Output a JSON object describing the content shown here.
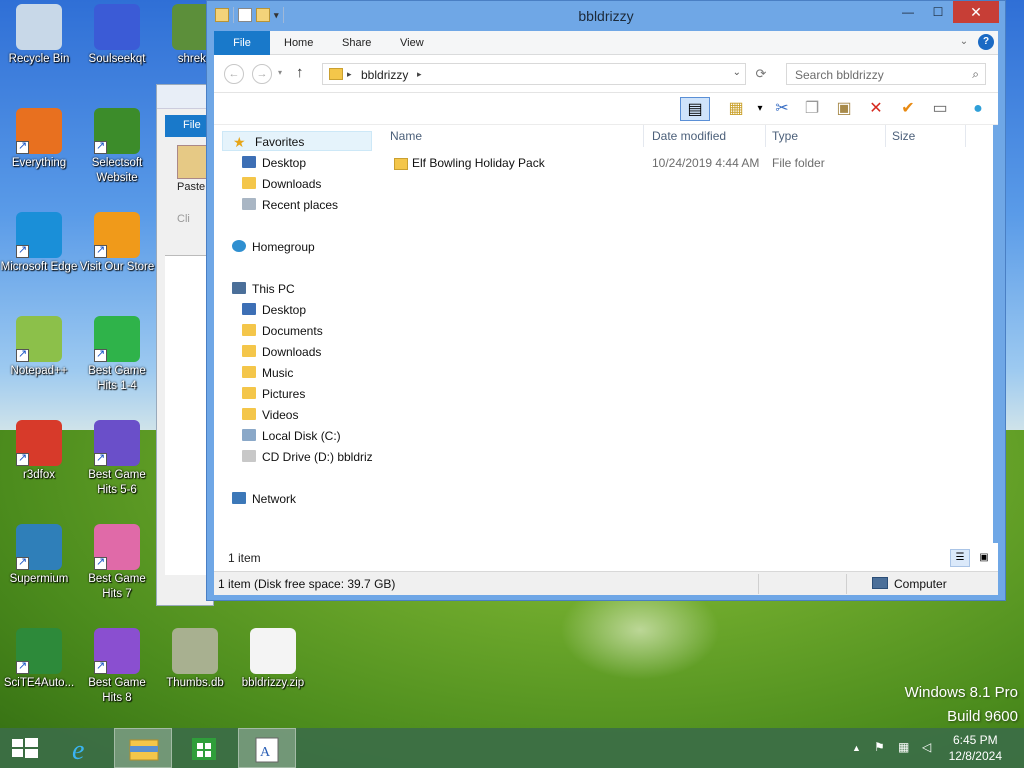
{
  "desktop": {
    "icons": [
      {
        "label": "Recycle Bin",
        "icon": "recycle-bin-icon",
        "color": "#c8d8e8"
      },
      {
        "label": "Soulseekqt",
        "icon": "bird-icon",
        "color": "#3b5bd6"
      },
      {
        "label": "shrekp",
        "icon": "shrek-icon",
        "color": "#5c8f3a"
      },
      {
        "label": "Everything",
        "icon": "magnifier-icon",
        "color": "#e8701f"
      },
      {
        "label": "Selectsoft Website",
        "icon": "selectsoft-icon",
        "color": "#3c8c2a"
      },
      {
        "label": "Microsoft Edge",
        "icon": "edge-icon",
        "color": "#1a8fd8"
      },
      {
        "label": "Visit Our Store",
        "icon": "store-icon",
        "color": "#f09a1a"
      },
      {
        "label": "Notepad++",
        "icon": "notepadpp-icon",
        "color": "#8cc04a"
      },
      {
        "label": "Best Game Hits 1-4",
        "icon": "green-dice-icon",
        "color": "#2fb34a"
      },
      {
        "label": "r3dfox",
        "icon": "fox-icon",
        "color": "#d73a2a"
      },
      {
        "label": "Best Game Hits 5-6",
        "icon": "purple-dice-icon",
        "color": "#6a4fc9"
      },
      {
        "label": "Supermium",
        "icon": "supermium-icon",
        "color": "#2f7fb9"
      },
      {
        "label": "Best Game Hits 7",
        "icon": "pink-dice-icon",
        "color": "#e06aa8"
      },
      {
        "label": "SciTE4Auto...",
        "icon": "scite-icon",
        "color": "#2d8a3a"
      },
      {
        "label": "Best Game Hits 8",
        "icon": "violet-dice-icon",
        "color": "#8a4fd0"
      },
      {
        "label": "Thumbs.db",
        "icon": "thumbs-db-icon",
        "color": "#a8b090"
      },
      {
        "label": "bbldrizzy.zip",
        "icon": "zip-icon",
        "color": "#f4f4f4"
      }
    ],
    "brand_line1": "Windows 8.1 Pro",
    "brand_line2": "Build 9600"
  },
  "bg_window": {
    "file_tab": "File",
    "paste_label": "Paste",
    "clip_label": "Cli"
  },
  "window": {
    "title": "bbldrizzy",
    "minimize": "—",
    "maximize": "☐",
    "close": "✕",
    "tabs": {
      "file": "File",
      "home": "Home",
      "share": "Share",
      "view": "View"
    },
    "expand_ribbon": "⌄",
    "help": "?",
    "address": {
      "path": "bbldrizzy",
      "sep1": "▸",
      "sep2": "▸",
      "dropdown": "⌄"
    },
    "search_placeholder": "Search bbldrizzy"
  },
  "navpane": {
    "favorites": "Favorites",
    "fav_items": [
      "Desktop",
      "Downloads",
      "Recent places"
    ],
    "homegroup": "Homegroup",
    "thispc": "This PC",
    "pc_items": [
      "Desktop",
      "Documents",
      "Downloads",
      "Music",
      "Pictures",
      "Videos",
      "Local Disk (C:)",
      "CD Drive (D:) bbldriz"
    ],
    "network": "Network"
  },
  "columns": {
    "name": "Name",
    "date": "Date modified",
    "type": "Type",
    "size": "Size"
  },
  "files": [
    {
      "name": "Elf Bowling Holiday Pack",
      "date": "10/24/2019 4:44 AM",
      "type": "File folder",
      "size": ""
    }
  ],
  "status": {
    "item_count": "1 item",
    "detail": "1 item (Disk free space: 39.7 GB)",
    "location": "Computer"
  },
  "taskbar": {
    "tray_up": "▲",
    "time": "6:45 PM",
    "date": "12/8/2024"
  }
}
